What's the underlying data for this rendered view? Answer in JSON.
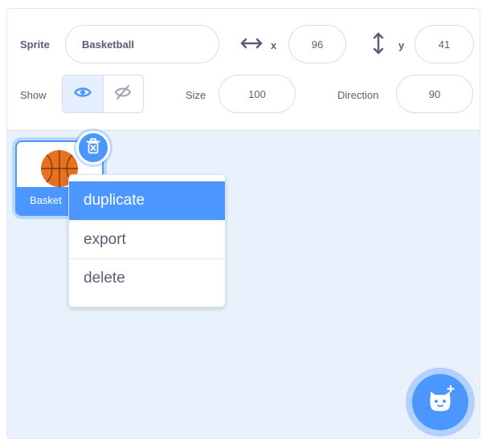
{
  "sprite_info": {
    "sprite_label": "Sprite",
    "sprite_name": "Basketball",
    "x_label": "x",
    "x_value": "96",
    "y_label": "y",
    "y_value": "41",
    "show_label": "Show",
    "show_visible": true,
    "size_label": "Size",
    "size_value": "100",
    "direction_label": "Direction",
    "direction_value": "90"
  },
  "sprite_list": {
    "items": [
      {
        "name": "Basket",
        "selected": true,
        "icon": "basketball-icon"
      }
    ]
  },
  "context_menu": {
    "items": [
      {
        "label": "duplicate",
        "highlighted": true
      },
      {
        "label": "export",
        "highlighted": false
      },
      {
        "label": "delete",
        "highlighted": false
      }
    ]
  },
  "colors": {
    "accent": "#4c97ff",
    "panel_bg": "#e9f1fc",
    "text": "#575e75",
    "basketball": "#e6711f"
  },
  "icons": [
    "x-arrows-icon",
    "y-arrows-icon",
    "eye-icon",
    "eye-off-icon",
    "trash-icon",
    "choose-sprite-icon"
  ]
}
